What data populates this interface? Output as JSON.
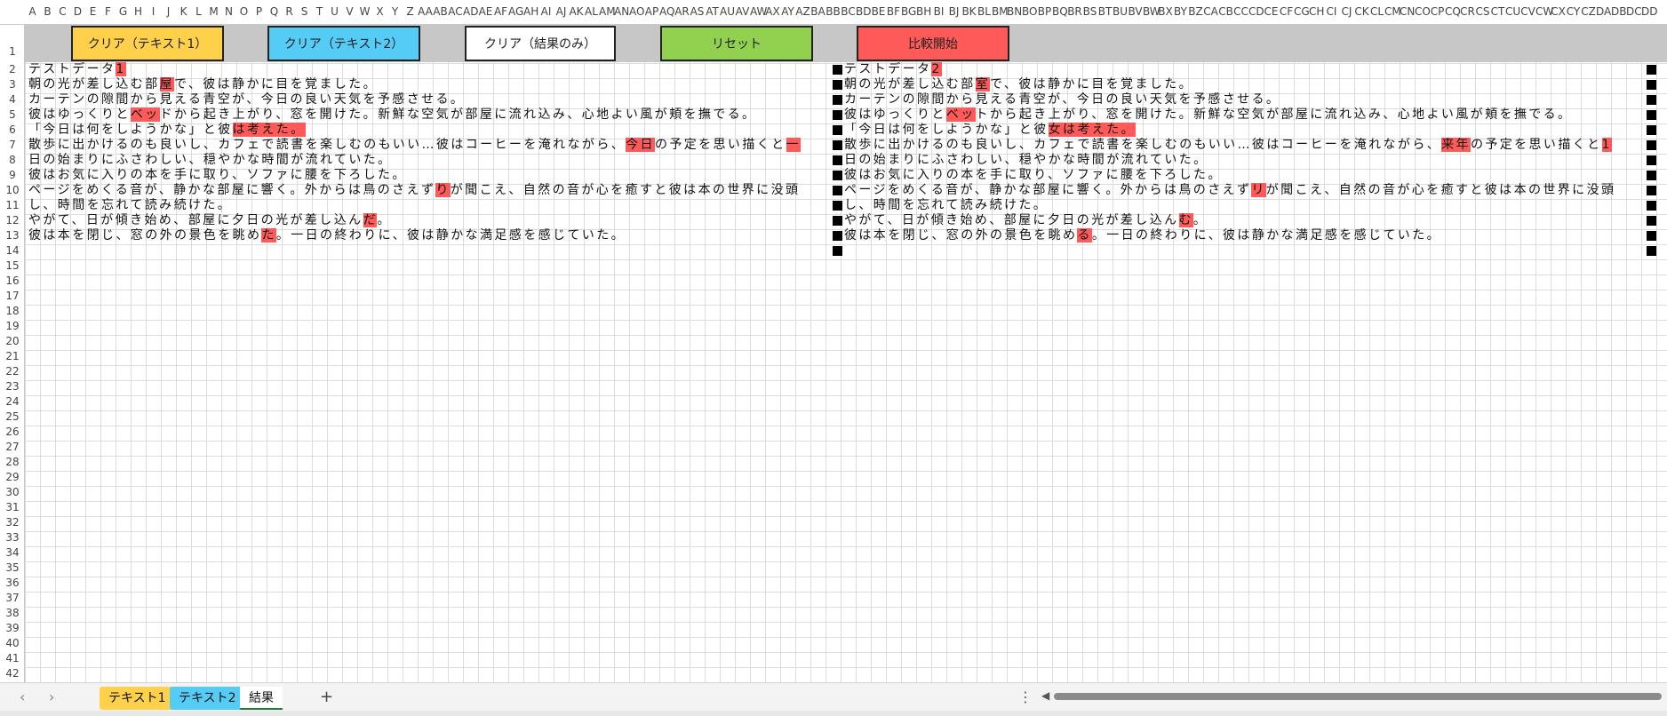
{
  "columns": [
    "A",
    "B",
    "C",
    "D",
    "E",
    "F",
    "G",
    "H",
    "I",
    "J",
    "K",
    "L",
    "M",
    "N",
    "O",
    "P",
    "Q",
    "R",
    "S",
    "T",
    "U",
    "V",
    "W",
    "X",
    "Y",
    "Z",
    "AA",
    "AB",
    "AC",
    "AD",
    "AE",
    "AF",
    "AG",
    "AH",
    "AI",
    "AJ",
    "AK",
    "AL",
    "AM",
    "AN",
    "AO",
    "AP",
    "AQ",
    "AR",
    "AS",
    "AT",
    "AU",
    "AV",
    "AW",
    "AX",
    "AY",
    "AZ",
    "BA",
    "BB",
    "BC",
    "BD",
    "BE",
    "BF",
    "BG",
    "BH",
    "BI",
    "BJ",
    "BK",
    "BL",
    "BM",
    "BN",
    "BO",
    "BP",
    "BQ",
    "BR",
    "BS",
    "BT",
    "BU",
    "BV",
    "BW",
    "BX",
    "BY",
    "BZ",
    "CA",
    "CB",
    "CC",
    "CD",
    "CE",
    "CF",
    "CG",
    "CH",
    "CI",
    "CJ",
    "CK",
    "CL",
    "CM",
    "CN",
    "CO",
    "CP",
    "CQ",
    "CR",
    "CS",
    "CT",
    "CU",
    "CV",
    "CW",
    "CX",
    "CY",
    "CZ",
    "DA",
    "DB",
    "DC",
    "DD"
  ],
  "rows": [
    "1",
    "2",
    "3",
    "4",
    "5",
    "6",
    "7",
    "8",
    "9",
    "10",
    "11",
    "12",
    "13",
    "14",
    "15",
    "16",
    "17",
    "18",
    "19",
    "20",
    "21",
    "22",
    "23",
    "24",
    "25",
    "26",
    "27",
    "28",
    "29",
    "30",
    "31",
    "32",
    "33",
    "34",
    "35",
    "36",
    "37",
    "38",
    "39",
    "40",
    "41",
    "42"
  ],
  "buttons": {
    "clear_text1": "クリア（テキスト1）",
    "clear_text2": "クリア（テキスト2）",
    "clear_result": "クリア（結果のみ）",
    "reset": "リセット",
    "compare": "比較開始"
  },
  "colors": {
    "clear_text1": "#ffd04a",
    "clear_text2": "#55ccf6",
    "clear_result": "#ffffff",
    "reset": "#92d050",
    "compare": "#ff5a5a",
    "highlight": "#ff5a5a"
  },
  "text1_rows": [
    [
      {
        "t": "テストデータ"
      },
      {
        "t": "1",
        "h": true
      }
    ],
    [
      {
        "t": "朝の光が差し込む部"
      },
      {
        "t": "屋",
        "h": true
      },
      {
        "t": "で、彼は静かに目を覚ました。"
      }
    ],
    [
      {
        "t": "カーテンの隙間から見える青空が、今日の良い天気を予感させる。"
      }
    ],
    [
      {
        "t": "彼はゆっくりと"
      },
      {
        "t": "ベッ",
        "h": true
      },
      {
        "t": "ドから起き上がり、窓を開けた。新鮮な空気が部屋に流れ込み、心地よい風が頬を撫でる。"
      }
    ],
    [
      {
        "t": "「今日は何をしようかな」と彼"
      },
      {
        "t": "は考えた。",
        "h": true
      }
    ],
    [
      {
        "t": "散歩に出かけるのも良いし、カフェで読書を楽しむのもいい…彼はコーヒーを淹れながら、"
      },
      {
        "t": "今日",
        "h": true
      },
      {
        "t": "の予定を思い描くと"
      },
      {
        "t": "一",
        "h": true
      }
    ],
    [
      {
        "t": "日の始まりにふさわしい、穏やかな時間が流れていた。"
      }
    ],
    [
      {
        "t": "彼はお気に入りの本を手に取り、ソファに腰を下ろした。"
      }
    ],
    [
      {
        "t": "ページをめくる音が、静かな部屋に響く。外からは鳥のさえず"
      },
      {
        "t": "り",
        "h": true
      },
      {
        "t": "が聞こえ、自然の音が心を癒すと彼は本の世界に没頭"
      }
    ],
    [
      {
        "t": "し、時間を忘れて読み続けた。"
      }
    ],
    [
      {
        "t": "やがて、日が傾き始め、部屋に夕日の光が差し込ん"
      },
      {
        "t": "だ",
        "h": true
      },
      {
        "t": "。"
      }
    ],
    [
      {
        "t": "彼は本を閉じ、窓の外の景色を眺め"
      },
      {
        "t": "た",
        "h": true
      },
      {
        "t": "。一日の終わりに、彼は静かな満足感を感じていた。"
      }
    ]
  ],
  "text2_rows": [
    [
      {
        "t": "テストデータ"
      },
      {
        "t": "2",
        "h": true
      }
    ],
    [
      {
        "t": "朝の光が差し込む部"
      },
      {
        "t": "室",
        "h": true
      },
      {
        "t": "で、彼は静かに目を覚ました。"
      }
    ],
    [
      {
        "t": "カーテンの隙間から見える青空が、今日の良い天気を予感させる。"
      }
    ],
    [
      {
        "t": "彼はゆっくりと"
      },
      {
        "t": "ベッ",
        "h": true
      },
      {
        "t": "トから起き上がり、窓を開けた。新鮮な空気が部屋に流れ込み、心地よい風が頬を撫でる。"
      }
    ],
    [
      {
        "t": "「今日は何をしようかな」と彼"
      },
      {
        "t": "女は考えた。",
        "h": true
      }
    ],
    [
      {
        "t": "散歩に出かけるのも良いし、カフェで読書を楽しむのもいい…彼はコーヒーを淹れながら、"
      },
      {
        "t": "来年",
        "h": true
      },
      {
        "t": "の予定を思い描くと"
      },
      {
        "t": "1",
        "h": true
      }
    ],
    [
      {
        "t": "日の始まりにふさわしい、穏やかな時間が流れていた。"
      }
    ],
    [
      {
        "t": "彼はお気に入りの本を手に取り、ソファに腰を下ろした。"
      }
    ],
    [
      {
        "t": "ページをめくる音が、静かな部屋に響く。外からは鳥のさえず"
      },
      {
        "t": "リ",
        "h": true
      },
      {
        "t": "が聞こえ、自然の音が心を癒すと彼は本の世界に没頭"
      }
    ],
    [
      {
        "t": "し、時間を忘れて読み続けた。"
      }
    ],
    [
      {
        "t": "やがて、日が傾き始め、部屋に夕日の光が差し込ん"
      },
      {
        "t": "む",
        "h": true
      },
      {
        "t": "。"
      }
    ],
    [
      {
        "t": "彼は本を閉じ、窓の外の景色を眺め"
      },
      {
        "t": "る",
        "h": true
      },
      {
        "t": "。一日の終わりに、彼は静かな満足感を感じていた。"
      }
    ]
  ],
  "tabs": {
    "text1": "テキスト1",
    "text2": "テキスト2",
    "result": "結果",
    "add": "+",
    "menu": "⋮"
  },
  "icons": {
    "prev_sheet": "chevron-left-icon",
    "next_sheet": "chevron-right-icon",
    "scroll_left": "triangle-left-icon"
  }
}
